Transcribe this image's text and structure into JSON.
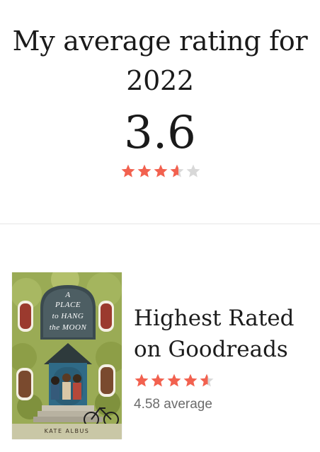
{
  "header": {
    "title_line1": "My average rating for",
    "title_line2": "2022"
  },
  "average": {
    "value": "3.6",
    "stars_rating": 3.6,
    "star_color": "#f2614f",
    "star_empty_color": "#d8d8d8"
  },
  "highest_rated": {
    "title_line1": "Highest Rated",
    "title_line2": "on Goodreads",
    "stars_rating": 4.58,
    "average_label": "4.58 average",
    "cover": {
      "title_lines": [
        "A",
        "PLACE",
        "to HANG",
        "the MOON"
      ],
      "author": "KATE ALBUS"
    }
  }
}
